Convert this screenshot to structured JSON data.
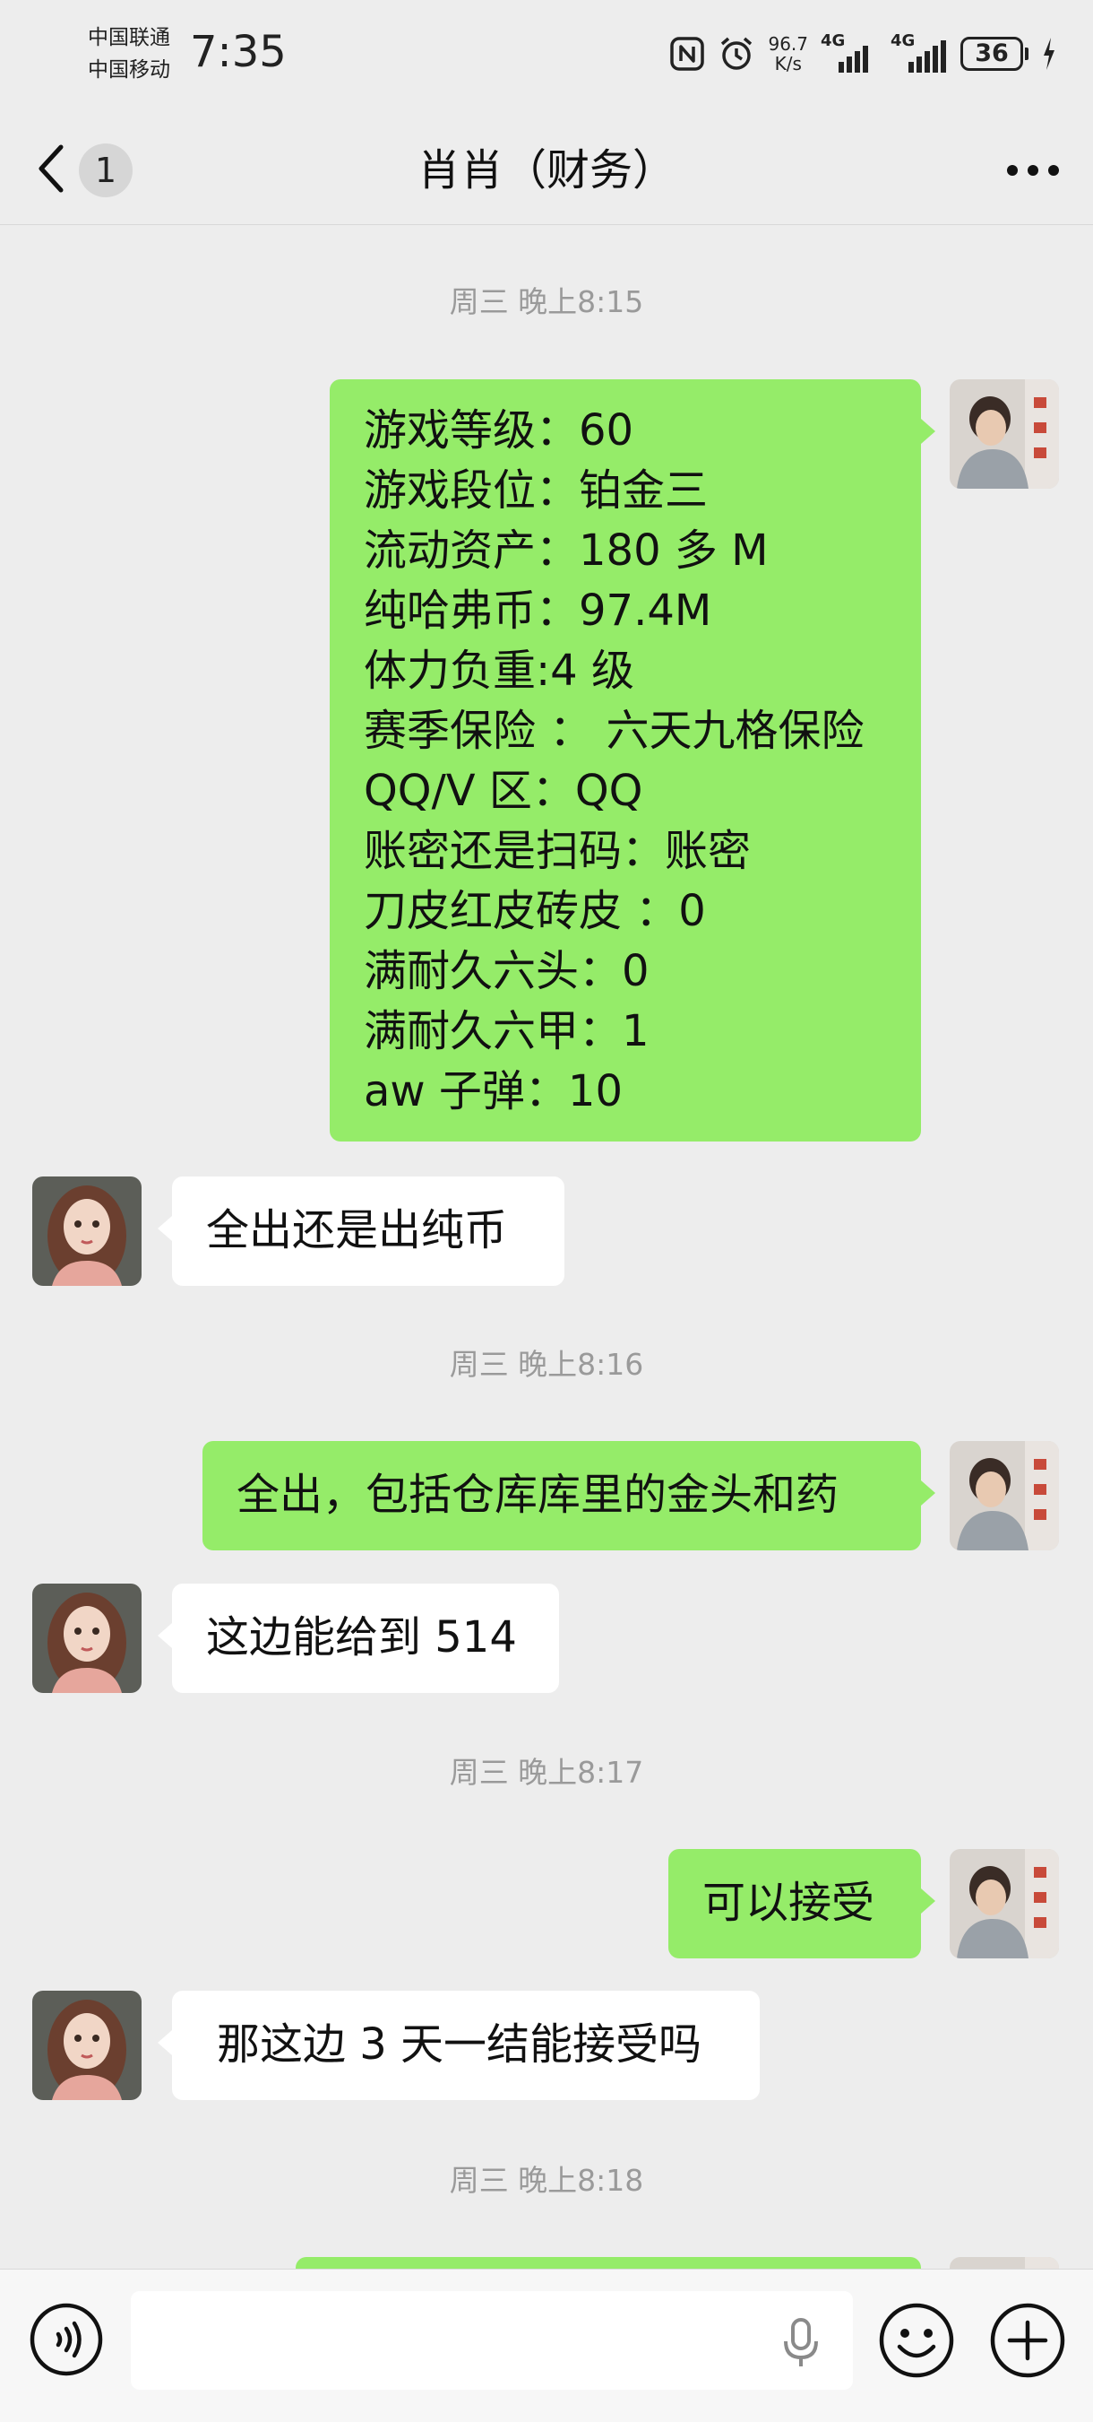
{
  "status_bar": {
    "carrier_1": "中国联通",
    "carrier_2": "中国移动",
    "time": "7:35",
    "speed_value": "96.7",
    "speed_unit": "K/s",
    "net_1": "4G",
    "net_2": "4G",
    "battery": "36"
  },
  "nav": {
    "unread_count": "1",
    "title": "肖肖（财务）"
  },
  "timestamps": [
    "周三 晚上8:15",
    "周三 晚上8:16",
    "周三 晚上8:17",
    "周三 晚上8:18"
  ],
  "messages": [
    {
      "direction": "outgoing",
      "lines": [
        "游戏等级：60",
        "游戏段位：铂金三",
        "流动资产：180 多 M",
        "纯哈弗币：97.4M",
        "体力负重:4 级",
        "赛季保险 ： 六天九格保险",
        "QQ/V 区：QQ",
        "账密还是扫码：账密",
        "刀皮红皮砖皮 ：0",
        "满耐久六头：0",
        "满耐久六甲：1",
        "aw 子弹：10"
      ]
    },
    {
      "direction": "incoming",
      "lines": [
        "全出还是出纯币"
      ]
    },
    {
      "direction": "outgoing",
      "lines": [
        "全出，包括仓库库里的金头和药"
      ]
    },
    {
      "direction": "incoming",
      "lines": [
        "这边能给到 514"
      ]
    },
    {
      "direction": "outgoing",
      "lines": [
        "可以接受"
      ]
    },
    {
      "direction": "incoming",
      "lines": [
        "那这边 3 天一结能接受吗"
      ]
    }
  ],
  "input_bar": {
    "placeholder": "",
    "icons": [
      "voice-icon",
      "mic-icon",
      "emoji-icon",
      "plus-icon"
    ]
  },
  "colors": {
    "outgoing_bubble": "#95ec69",
    "incoming_bubble": "#ffffff",
    "background": "#ededed"
  }
}
